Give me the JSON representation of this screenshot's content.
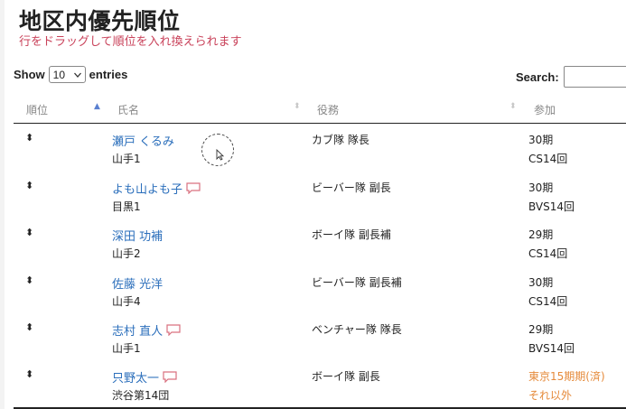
{
  "page": {
    "title": "地区内優先順位",
    "subtitle": "行をドラッグして順位を入れ換えられます"
  },
  "table_controls": {
    "show_label": "Show",
    "entries_value": "10",
    "entries_label": "entries",
    "search_label": "Search:",
    "search_value": ""
  },
  "columns": [
    {
      "label": "順位",
      "sort": "asc"
    },
    {
      "label": "氏名",
      "sort": "none"
    },
    {
      "label": "役務",
      "sort": "none"
    },
    {
      "label": "参加",
      "sort": "none"
    }
  ],
  "rows": [
    {
      "name": "瀬戸 くるみ",
      "sub": "山手1",
      "role": "カブ隊 隊長",
      "p1": "30期",
      "p2": "CS14回",
      "chat": false,
      "warn": false
    },
    {
      "name": "よも山よも子",
      "sub": "目黒1",
      "role": "ビーバー隊 副長",
      "p1": "30期",
      "p2": "BVS14回",
      "chat": true,
      "warn": false
    },
    {
      "name": "深田 功補",
      "sub": "山手2",
      "role": "ボーイ隊 副長補",
      "p1": "29期",
      "p2": "CS14回",
      "chat": false,
      "warn": false
    },
    {
      "name": "佐藤 光洋",
      "sub": "山手4",
      "role": "ビーバー隊 副長補",
      "p1": "30期",
      "p2": "CS14回",
      "chat": false,
      "warn": false
    },
    {
      "name": "志村 直人",
      "sub": "山手1",
      "role": "ベンチャー隊 隊長",
      "p1": "29期",
      "p2": "BVS14回",
      "chat": true,
      "warn": false
    },
    {
      "name": "只野太一",
      "sub": "渋谷第14団",
      "role": "ボーイ隊 副長",
      "p1": "東京15期期(済)",
      "p2": "それ以外",
      "chat": true,
      "warn": true
    }
  ],
  "colors": {
    "accent_link": "#2a6ebb",
    "subtitle": "#c9425a",
    "warning": "#e58a3a",
    "chat_icon": "#d9707f"
  }
}
